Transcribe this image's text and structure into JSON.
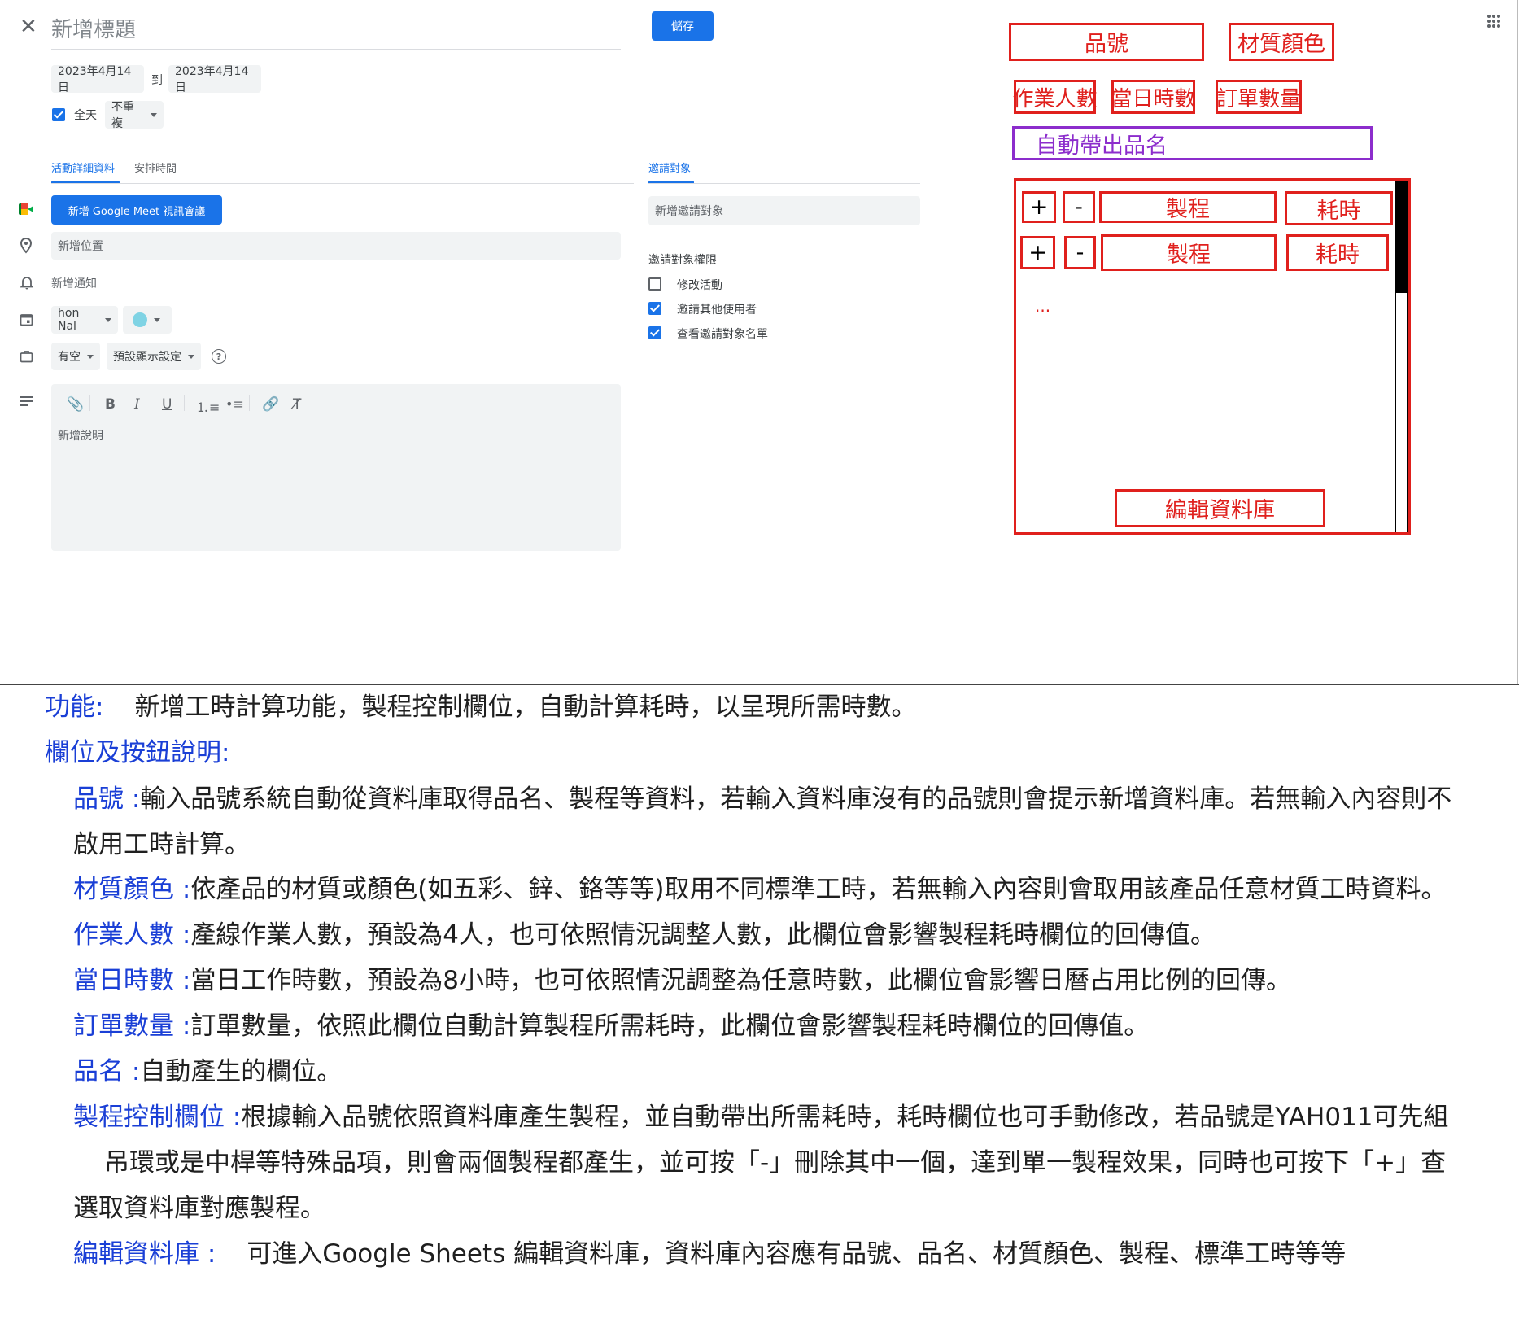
{
  "header": {
    "close_icon": "close-icon",
    "title_placeholder": "新增標題",
    "save_label": "儲存",
    "apps_icon": "apps-grid-icon"
  },
  "dates": {
    "start": "2023年4月14日",
    "to": "到",
    "end": "2023年4月14日"
  },
  "allday": {
    "label": "全天",
    "checked": true,
    "repeat": "不重複"
  },
  "tabs": [
    {
      "label": "活動詳細資料",
      "active": true
    },
    {
      "label": "安排時間",
      "active": false
    }
  ],
  "meet_button": "新增 Google Meet 視訊會議",
  "location_placeholder": "新增位置",
  "notification_label": "新增通知",
  "calendar_name": "hon Nal",
  "calendar_color": "#7fd3e4",
  "availability": "有空",
  "visibility": "預設顯示設定",
  "description_placeholder": "新增說明",
  "guests": {
    "tab_label": "邀請對象",
    "placeholder": "新增邀請對象",
    "permissions_title": "邀請對象權限",
    "permissions": [
      {
        "label": "修改活動",
        "checked": false
      },
      {
        "label": "邀請其他使用者",
        "checked": true
      },
      {
        "label": "查看邀請對象名單",
        "checked": true
      }
    ]
  },
  "mockup": {
    "part_no": "品號",
    "material_color": "材質顏色",
    "workers": "作業人數",
    "daily_hours": "當日時數",
    "order_qty": "訂單數量",
    "auto_name": "自動帶出品名",
    "rows": [
      {
        "plus": "+",
        "minus": "-",
        "process": "製程",
        "time": "耗時"
      },
      {
        "plus": "+",
        "minus": "-",
        "process": "製程",
        "time": "耗時"
      }
    ],
    "ellipsis": "...",
    "edit_db": "編輯資料庫"
  },
  "description": {
    "feature_key": "功能:",
    "feature_text": "新增工時計算功能，製程控制欄位，自動計算耗時，以呈現所需時數。",
    "fields_title": "欄位及按鈕說明:",
    "items": [
      {
        "key": "品號 :",
        "text": "輸入品號系統自動從資料庫取得品名、製程等資料，若輸入資料庫沒有的品號則會提示新增資料庫。若無輸入內容則不"
      },
      {
        "key": "",
        "text": "啟用工時計算。"
      },
      {
        "key": "材質顏色 :",
        "text": "依產品的材質或顏色(如五彩、鋅、鉻等等)取用不同標準工時，若無輸入內容則會取用該產品任意材質工時資料。"
      },
      {
        "key": "作業人數 :",
        "text": "產線作業人數，預設為4人，也可依照情況調整人數，此欄位會影響製程耗時欄位的回傳值。"
      },
      {
        "key": "當日時數 :",
        "text": "當日工作時數，預設為8小時，也可依照情況調整為任意時數，此欄位會影響日曆占用比例的回傳。"
      },
      {
        "key": "訂單數量 :",
        "text": "訂單數量，依照此欄位自動計算製程所需耗時，此欄位會影響製程耗時欄位的回傳值。"
      },
      {
        "key": "品名 :",
        "text": "自動產生的欄位。"
      },
      {
        "key": "製程控制欄位 :",
        "text": "根據輸入品號依照資料庫產生製程，並自動帶出所需耗時，耗時欄位也可手動修改，若品號是YAH011可先組"
      },
      {
        "key": "",
        "text": "吊環或是中桿等特殊品項，則會兩個製程都產生，並可按「-」刪除其中一個，達到單一製程效果，同時也可按下「+」查"
      },
      {
        "key": "",
        "text": "選取資料庫對應製程。"
      },
      {
        "key": "編輯資料庫 :",
        "text": "可進入Google Sheets 編輯資料庫，資料庫內容應有品號、品名、材質顏色、製程、標準工時等等"
      }
    ]
  }
}
